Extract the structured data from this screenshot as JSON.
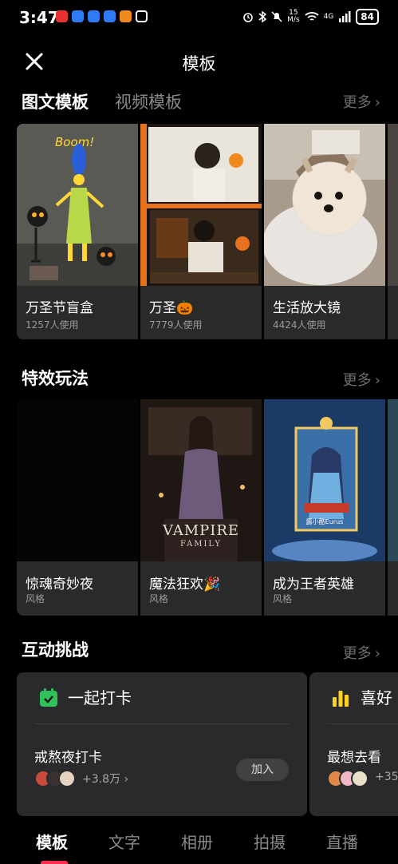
{
  "status_bar": {
    "time": "3:47",
    "speed_top": "15",
    "speed_bottom": "M/s",
    "network": "4G",
    "battery": "84",
    "app_icons": [
      "#e8322f",
      "#2f7bf5",
      "#2f7bf5",
      "#2f7bf5",
      "#f08a1c",
      "#ffffff"
    ]
  },
  "header": {
    "title": "模板",
    "close_icon": "close-icon"
  },
  "tabs": [
    {
      "label": "图文模板",
      "active": true
    },
    {
      "label": "视频模板",
      "active": false
    }
  ],
  "more_label": "更多",
  "templates": {
    "items": [
      {
        "title": "万圣节盲盒",
        "usage": "1257人使用"
      },
      {
        "title": "万圣🎃",
        "usage": "7779人使用"
      },
      {
        "title": "生活放大镜",
        "usage": "4424人使用"
      }
    ]
  },
  "effects": {
    "title": "特效玩法",
    "items": [
      {
        "title": "惊魂奇妙夜",
        "tag": "风格"
      },
      {
        "title": "魔法狂欢🎉",
        "tag": "风格"
      },
      {
        "title": "成为王者英雄",
        "tag": "风格"
      }
    ],
    "poster_text_1": "VAMPIRE",
    "poster_text_2": "FAMILY",
    "poster_badge": "露小酷Eurus"
  },
  "challenges": {
    "title": "互动挑战",
    "cards": [
      {
        "label": "一起打卡",
        "item_title": "戒熬夜打卡",
        "count": "+3.8万",
        "join": "加入",
        "accent": "#2fc25b"
      },
      {
        "label": "喜好",
        "item_title": "最想去看",
        "count": "+35",
        "accent": "#ffd21e"
      }
    ]
  },
  "bottom_nav": [
    {
      "label": "模板",
      "active": true
    },
    {
      "label": "文字",
      "active": false
    },
    {
      "label": "相册",
      "active": false
    },
    {
      "label": "拍摄",
      "active": false
    },
    {
      "label": "直播",
      "active": false
    }
  ],
  "accent_color": "#ff2b4e"
}
